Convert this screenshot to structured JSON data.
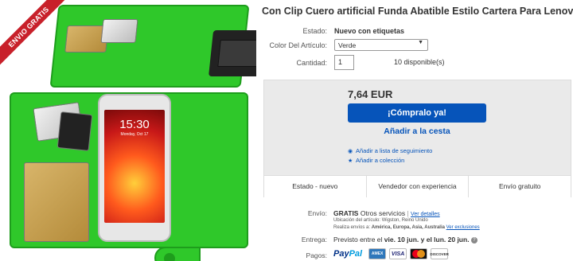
{
  "image": {
    "ribbon": "ENVIO GRATIS",
    "phone_time": "15:30",
    "phone_date": "Monday, Oct 17"
  },
  "title": "Con Clip Cuero artificial Funda Abatible Estilo Cartera Para Lenovo Moto G",
  "details": {
    "estado_label": "Estado:",
    "estado_value": "Nuevo con etiquetas",
    "color_label": "Color Del Artículo:",
    "color_value": "Verde",
    "cantidad_label": "Cantidad:",
    "cantidad_value": "1",
    "disponible": "10 disponible(s)"
  },
  "buy_box": {
    "price": "7,64 EUR",
    "buy_now": "¡Cómpralo ya!",
    "add_to_cart": "Añadir a la cesta",
    "watchlist": "Añadir a lista de seguimiento",
    "collection": "Añadir a colección",
    "trust": [
      "Estado - nuevo",
      "Vendedor con experiencia",
      "Envío gratuito"
    ]
  },
  "shipping": {
    "envio_label": "Envío:",
    "envio_free": "GRATIS",
    "envio_service": "Otros servicios",
    "envio_details": "Ver detalles",
    "location_line": "Ubicación del artículo: Wigston, Reino Unido",
    "ships_to_prefix": "Realiza envíos a:",
    "ships_to": "América, Europa, Asia, Australia",
    "exclusions": "Ver exclusiones",
    "entrega_label": "Entrega:",
    "entrega_prefix": "Previsto entre el",
    "entrega_dates": "vie. 10 jun. y el lun. 20 jun.",
    "pagos_label": "Pagos:",
    "paypal_a": "Pay",
    "paypal_b": "Pal",
    "card_amex": "AMEX",
    "card_visa": "VISA",
    "card_discover": "DISCOVER"
  },
  "colors": {
    "link_blue": "#0654ba",
    "button_blue": "#0654ba",
    "wallet_green": "#2fc82a",
    "ribbon_red": "#c8202a"
  },
  "icons": [
    "eye-icon",
    "star-icon",
    "info-icon",
    "chevron-down-icon"
  ]
}
